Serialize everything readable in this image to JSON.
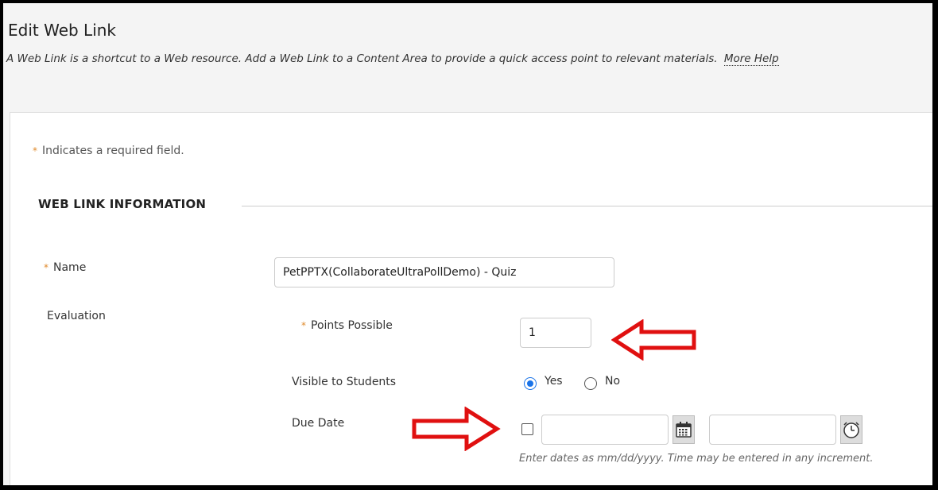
{
  "header": {
    "title": "Edit Web Link",
    "description": "A Web Link is a shortcut to a Web resource. Add a Web Link to a Content Area to provide a quick access point to relevant materials.",
    "more_help": "More Help"
  },
  "required_note": "Indicates a required field.",
  "required_marker": "*",
  "section": {
    "title": "WEB LINK INFORMATION"
  },
  "fields": {
    "name": {
      "label": "Name",
      "value": "PetPPTX(CollaborateUltraPollDemo) - Quiz"
    },
    "evaluation": {
      "label": "Evaluation"
    },
    "points": {
      "label": "Points Possible",
      "value": "1"
    },
    "visible": {
      "label": "Visible to Students",
      "yes": "Yes",
      "no": "No",
      "selected": "Yes"
    },
    "due_date": {
      "label": "Due Date",
      "date_value": "",
      "time_value": "",
      "hint": "Enter dates as mm/dd/yyyy. Time may be entered in any increment."
    }
  },
  "colors": {
    "required": "#e08a2c",
    "annotation_arrow": "#e01010",
    "radio_selected": "#1a73e8"
  },
  "icons": [
    "calendar-icon",
    "clock-icon",
    "arrow-left-annotation",
    "arrow-right-annotation"
  ]
}
